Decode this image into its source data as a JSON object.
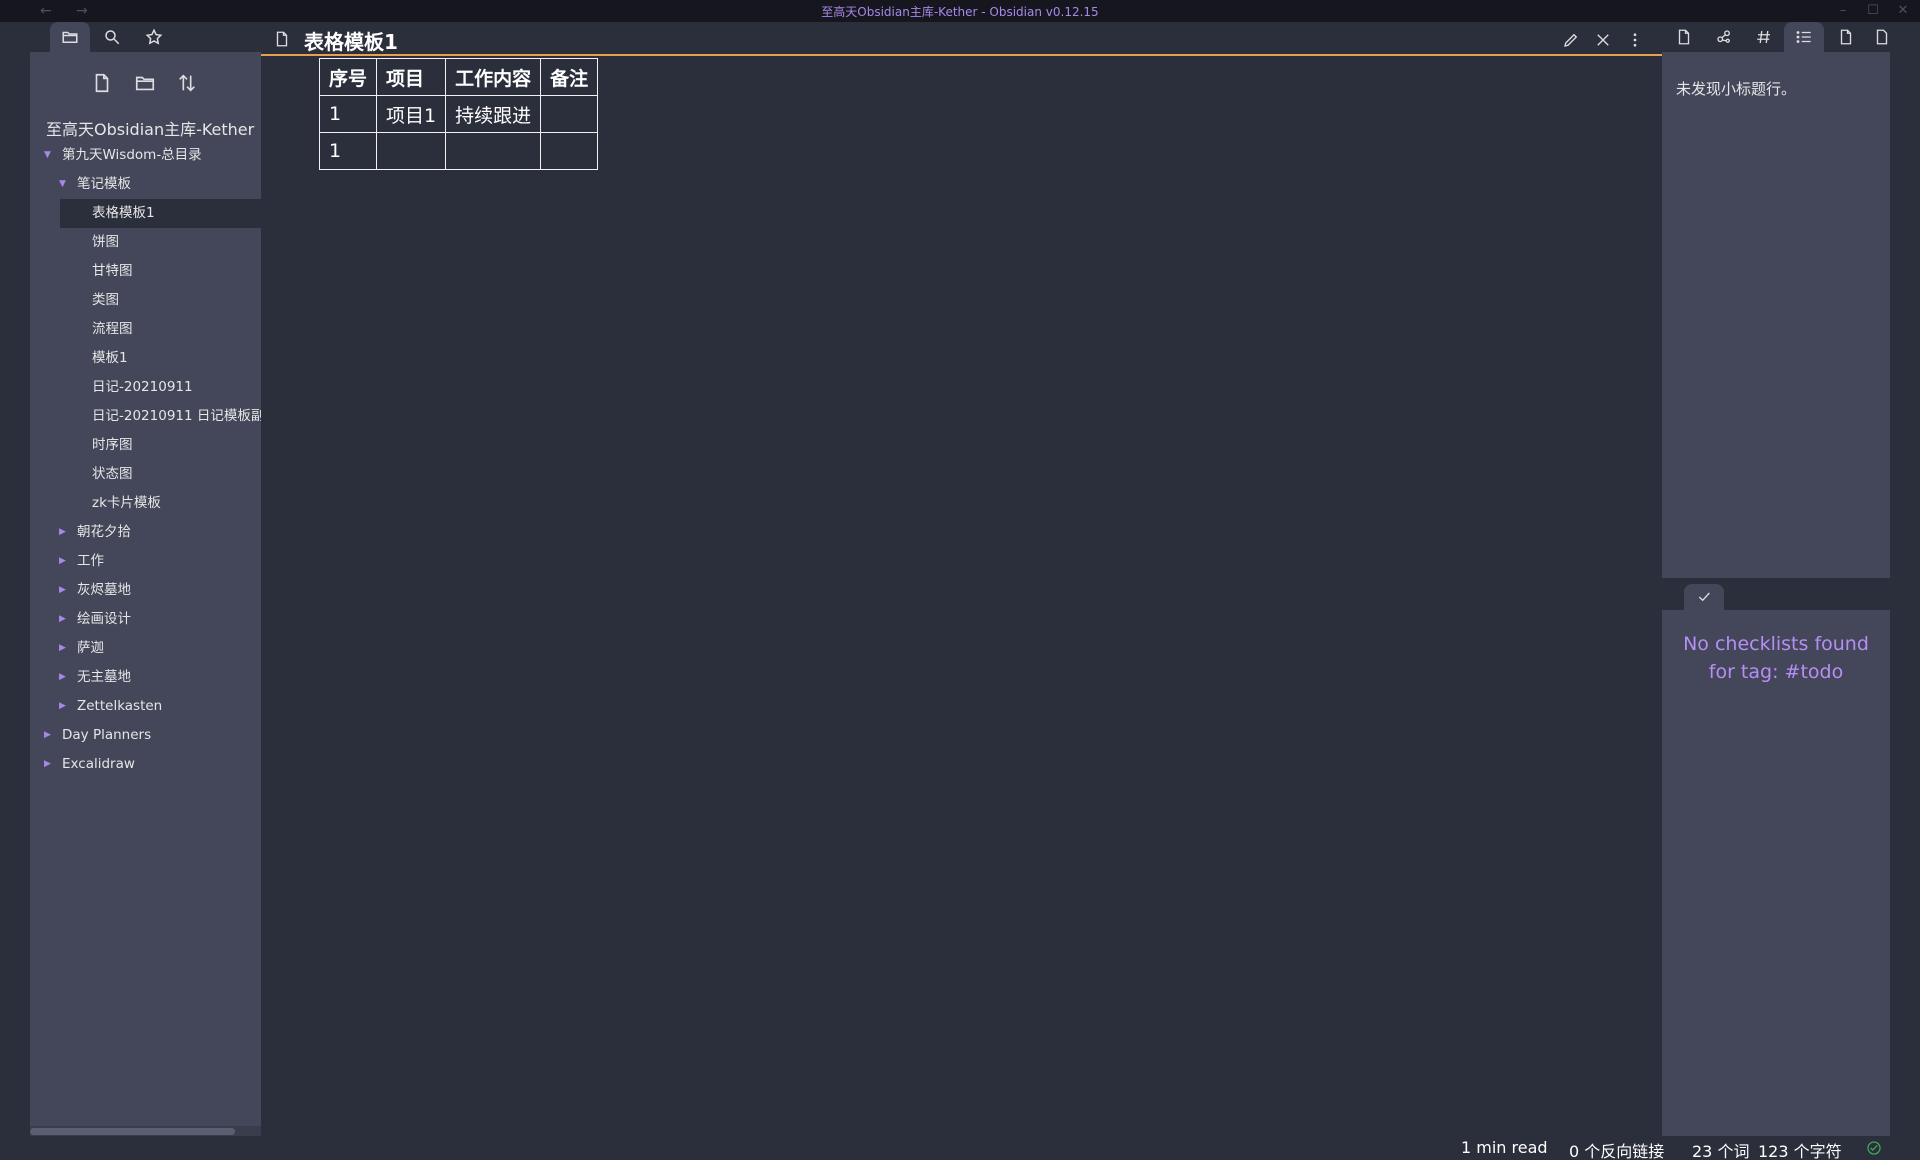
{
  "window": {
    "title": "至高天Obsidian主库-Kether - Obsidian v0.12.15",
    "nav_back": "←",
    "nav_forward": "→",
    "min": "–",
    "max": "☐",
    "close": "✕"
  },
  "left_sidebar": {
    "tabs": [
      {
        "name": "file-explorer",
        "icon": "folder-icon",
        "active": true
      },
      {
        "name": "search",
        "icon": "search-icon",
        "active": false
      },
      {
        "name": "starred",
        "icon": "star-icon",
        "active": false
      }
    ],
    "actions": [
      {
        "label": "New note",
        "icon": "new-note-icon"
      },
      {
        "label": "New folder",
        "icon": "new-folder-icon"
      },
      {
        "label": "Change sort order",
        "icon": "sort-icon"
      }
    ],
    "vault_name": "至高天Obsidian主库-Kether",
    "tree": [
      {
        "label": "第九天Wisdom-总目录",
        "level": 0,
        "type": "folder",
        "expanded": true
      },
      {
        "label": "笔记模板",
        "level": 1,
        "type": "folder",
        "expanded": true
      },
      {
        "label": "表格模板1",
        "level": 2,
        "type": "file",
        "selected": true
      },
      {
        "label": "饼图",
        "level": 2,
        "type": "file"
      },
      {
        "label": "甘特图",
        "level": 2,
        "type": "file"
      },
      {
        "label": "类图",
        "level": 2,
        "type": "file"
      },
      {
        "label": "流程图",
        "level": 2,
        "type": "file"
      },
      {
        "label": "模板1",
        "level": 2,
        "type": "file"
      },
      {
        "label": "日记-20210911",
        "level": 2,
        "type": "file"
      },
      {
        "label": "日记-20210911 日记模板副",
        "level": 2,
        "type": "file"
      },
      {
        "label": "时序图",
        "level": 2,
        "type": "file"
      },
      {
        "label": "状态图",
        "level": 2,
        "type": "file"
      },
      {
        "label": "zk卡片模板",
        "level": 2,
        "type": "file"
      },
      {
        "label": "朝花夕拾",
        "level": 1,
        "type": "folder",
        "expanded": false
      },
      {
        "label": "工作",
        "level": 1,
        "type": "folder",
        "expanded": false
      },
      {
        "label": "灰烬墓地",
        "level": 1,
        "type": "folder",
        "expanded": false
      },
      {
        "label": "绘画设计",
        "level": 1,
        "type": "folder",
        "expanded": false
      },
      {
        "label": "萨迦",
        "level": 1,
        "type": "folder",
        "expanded": false
      },
      {
        "label": "无主墓地",
        "level": 1,
        "type": "folder",
        "expanded": false
      },
      {
        "label": "Zettelkasten",
        "level": 1,
        "type": "folder",
        "expanded": false
      },
      {
        "label": "Day Planners",
        "level": 0,
        "type": "folder",
        "expanded": false
      },
      {
        "label": "Excalidraw",
        "level": 0,
        "type": "folder",
        "expanded": false
      }
    ]
  },
  "editor": {
    "title": "表格模板1",
    "actions": [
      {
        "name": "edit",
        "icon": "pencil-icon"
      },
      {
        "name": "close",
        "icon": "close-icon"
      },
      {
        "name": "more-options",
        "icon": "more-vertical-icon"
      }
    ],
    "table": {
      "headers": [
        "序号",
        "项目",
        "工作内容",
        "备注"
      ],
      "rows": [
        [
          "1",
          "项目1",
          "持续跟进",
          ""
        ],
        [
          "1",
          "",
          "",
          ""
        ]
      ]
    }
  },
  "right_sidebar": {
    "tabs": [
      {
        "name": "backlinks",
        "icon": "file-icon"
      },
      {
        "name": "graph",
        "icon": "graph-icon"
      },
      {
        "name": "tags",
        "icon": "hash-icon"
      },
      {
        "name": "outline",
        "icon": "list-icon",
        "active": true
      },
      {
        "name": "local-file",
        "icon": "file-icon"
      },
      {
        "name": "more",
        "icon": "file-icon"
      }
    ],
    "outline_empty_text": "未发现小标题行。",
    "checklist_tab_icon": "check-icon",
    "checklist_message": "No checklists found for tag: #todo"
  },
  "statusbar": {
    "read_time": "1 min read",
    "backlinks": "0 个反向链接",
    "words": "23 个词",
    "chars": "123 个字符"
  },
  "colors": {
    "accent": "#a787e8",
    "active_line": "#e8a04f",
    "checklist_text": "#b78ef5",
    "sync_ok": "#3ea35a"
  }
}
